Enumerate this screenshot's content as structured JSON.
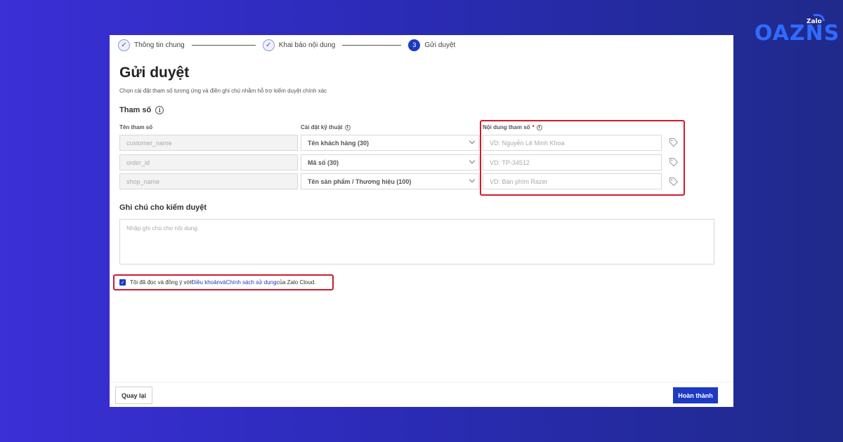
{
  "brand": {
    "logo_text": "OAZNS",
    "badge": "Zalo"
  },
  "stepper": {
    "steps": [
      {
        "index": "✓",
        "label": "Thông tin chung",
        "state": "done"
      },
      {
        "index": "✓",
        "label": "Khai báo nội dung",
        "state": "done"
      },
      {
        "index": "3",
        "label": "Gửi duyệt",
        "state": "active"
      }
    ]
  },
  "page": {
    "title": "Gửi duyệt",
    "subtitle": "Chọn cài đặt tham số tương ứng và điền ghi chú nhằm hỗ trợ kiểm duyệt chính xác"
  },
  "params": {
    "section_title": "Tham số",
    "columns": {
      "name": "Tên tham số",
      "setting": "Cài đặt kỹ thuật",
      "content": "Nội dung tham số",
      "required_mark": "*"
    },
    "rows": [
      {
        "name": "customer_name",
        "setting": "Tên khách hàng (30)",
        "placeholder": "VD: Nguyễn Lê Minh Khoa"
      },
      {
        "name": "order_id",
        "setting": "Mã số (30)",
        "placeholder": "VD: TP-34512"
      },
      {
        "name": "shop_name",
        "setting": "Tên sản phẩm / Thương hiệu (100)",
        "placeholder": "VD: Bàn phím Razer"
      }
    ]
  },
  "notes": {
    "section_title": "Ghi chú cho kiểm duyệt",
    "placeholder": "Nhập ghi chú cho nội dung"
  },
  "agreement": {
    "checked": true,
    "prefix": "Tôi đã đọc và đồng ý với ",
    "terms_link": "Điều khoản",
    "and_text": " và ",
    "policy_link": "Chính sách sử dụng",
    "suffix": " của Zalo Cloud."
  },
  "footer": {
    "back_label": "Quay lại",
    "done_label": "Hoàn thành"
  },
  "colors": {
    "accent": "#1d3ac4",
    "highlight": "#d11b2a",
    "logo": "#2f6bff"
  }
}
